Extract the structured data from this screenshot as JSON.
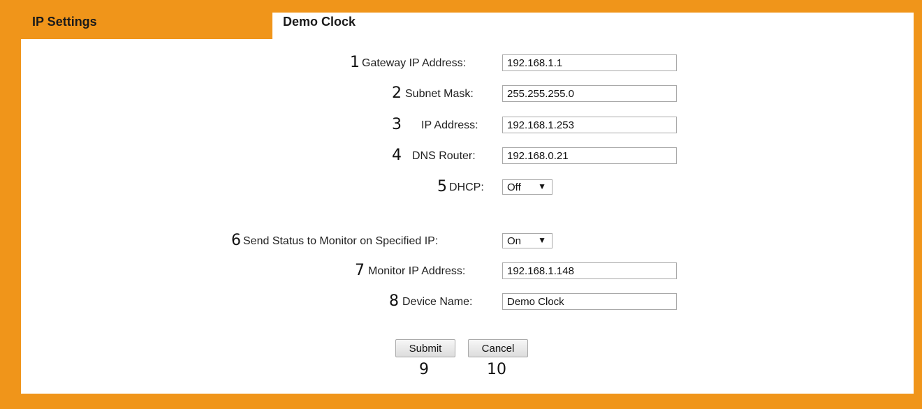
{
  "tabs": [
    {
      "label": "IP Settings",
      "active": false
    },
    {
      "label": "Demo Clock",
      "active": true
    }
  ],
  "form": {
    "gateway": {
      "number": "1",
      "label": "Gateway IP Address:",
      "value": "192.168.1.1"
    },
    "subnet": {
      "number": "2",
      "label": "Subnet Mask:",
      "value": "255.255.255.0"
    },
    "ip": {
      "number": "3",
      "label": "IP Address:",
      "value": "192.168.1.253"
    },
    "dns": {
      "number": "4",
      "label": "DNS Router:",
      "value": "192.168.0.21"
    },
    "dhcp": {
      "number": "5",
      "label": "DHCP:",
      "selected": "Off"
    },
    "send_status": {
      "number": "6",
      "label": "Send Status to Monitor on Specified IP:",
      "selected": "On"
    },
    "monitor_ip": {
      "number": "7",
      "label": "Monitor IP Address:",
      "value": "192.168.1.148"
    },
    "device_name": {
      "number": "8",
      "label": "Device Name:",
      "value": "Demo Clock"
    }
  },
  "buttons": {
    "submit": {
      "label": "Submit",
      "number": "9"
    },
    "cancel": {
      "label": "Cancel",
      "number": "10"
    }
  },
  "colors": {
    "frame": "#f0951a",
    "panel": "#ffffff"
  }
}
